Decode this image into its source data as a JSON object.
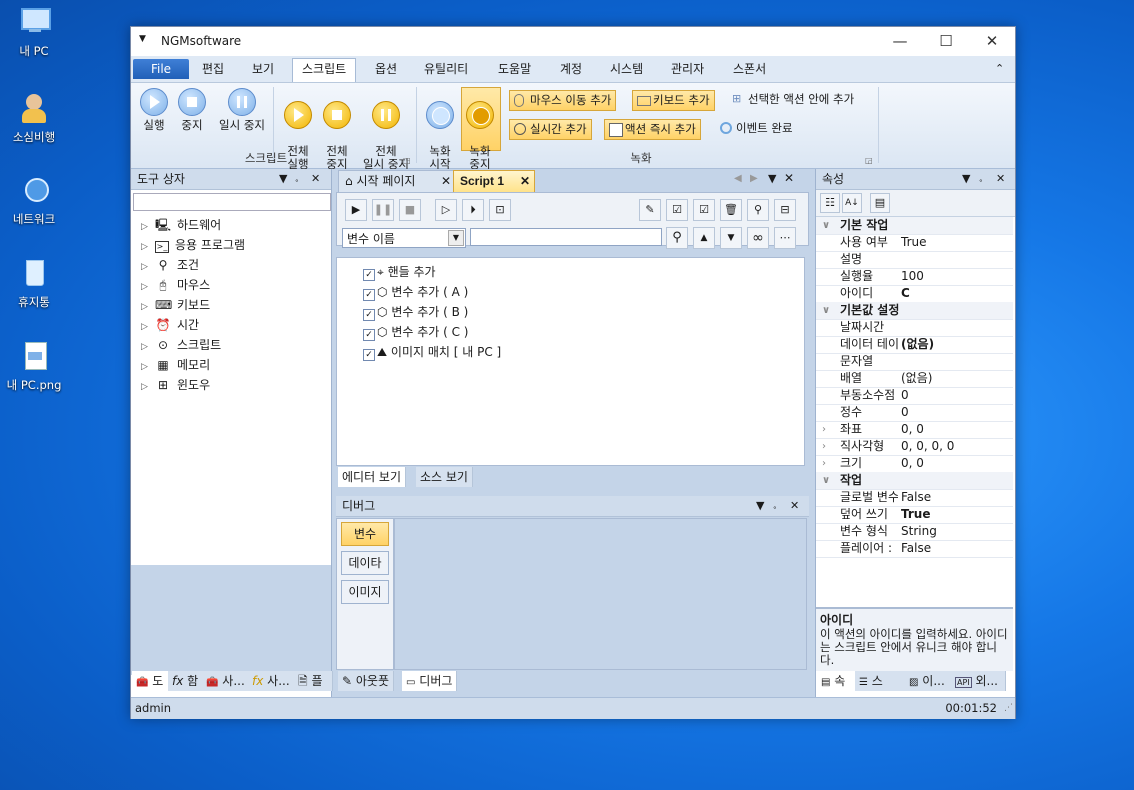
{
  "desktop": {
    "icons": [
      {
        "label": "내 PC",
        "icon": "computer-icon"
      },
      {
        "label": "소심비행",
        "icon": "user-folder-icon"
      },
      {
        "label": "네트워크",
        "icon": "network-icon"
      },
      {
        "label": "휴지통",
        "icon": "recycle-bin-icon"
      },
      {
        "label": "내 PC.png",
        "icon": "image-file-icon"
      }
    ]
  },
  "window": {
    "title": "NGMsoftware",
    "controls": {
      "minimize": "—",
      "maximize": "☐",
      "close": "✕"
    }
  },
  "menu": {
    "items": [
      "File",
      "편집",
      "보기",
      "스크립트",
      "옵션",
      "유틸리티",
      "도움말",
      "계정",
      "시스템",
      "관리자",
      "스폰서"
    ],
    "active": "스크립트",
    "collapse": "⌃"
  },
  "ribbon": {
    "script_group": {
      "label": "스크립트",
      "buttons": [
        "실행",
        "중지",
        "일시 중지",
        "전체\n실행",
        "전체\n중지",
        "전체\n일시 중지"
      ]
    },
    "record_group": {
      "label": "녹화",
      "record": "녹화\n시작",
      "stop": "녹화\n중지",
      "mouse_add": "마우스 이동 추가",
      "keyboard_add": "키보드 추가",
      "selected_add": "선택한 액션 안에 추가",
      "realtime_add": "실시간 추가",
      "instant_add": "액션 즉시 추가",
      "event_done": "이벤트 완료"
    }
  },
  "toolbox": {
    "title": "도구 상자",
    "search_value": "",
    "items": [
      "하드웨어",
      "응용 프로그램",
      "조건",
      "마우스",
      "키보드",
      "시간",
      "스크립트",
      "메모리",
      "윈도우"
    ],
    "bottom_tabs": [
      "도",
      "함",
      "사...",
      "사...",
      "플"
    ]
  },
  "editor": {
    "tabs": [
      "시작 페이지",
      "Script 1"
    ],
    "variable_select": "변수 이름",
    "search_value": "",
    "lines": [
      "핸들 추가",
      "변수 추가 ( A )",
      "변수 추가 ( B )",
      "변수 추가 ( C )",
      "이미지 매치 [ 내 PC ]"
    ],
    "view_tabs": [
      "에디터 보기",
      "소스 보기"
    ]
  },
  "debug": {
    "title": "디버그",
    "buttons": [
      "변수",
      "데이타",
      "이미지"
    ],
    "bottom_tabs": [
      "아웃풋",
      "디버그"
    ]
  },
  "properties": {
    "title": "속성",
    "categories": [
      {
        "name": "기본 작업",
        "rows": [
          {
            "k": "사용 여부",
            "v": "True",
            "bold": false
          },
          {
            "k": "설명",
            "v": "",
            "bold": false
          },
          {
            "k": "실행율",
            "v": "100",
            "bold": false
          },
          {
            "k": "아이디",
            "v": "C",
            "bold": true
          }
        ]
      },
      {
        "name": "기본값 설정",
        "rows": [
          {
            "k": "날짜시간",
            "v": "",
            "bold": false
          },
          {
            "k": "데이터 테이",
            "v": "(없음)",
            "bold": true
          },
          {
            "k": "문자열",
            "v": "",
            "bold": false
          },
          {
            "k": "배열",
            "v": "(없음)",
            "bold": false
          },
          {
            "k": "부동소수점",
            "v": "0",
            "bold": false
          },
          {
            "k": "정수",
            "v": "0",
            "bold": false
          },
          {
            "k": "좌표",
            "v": "0, 0",
            "bold": false,
            "exp": true
          },
          {
            "k": "직사각형",
            "v": "0, 0, 0, 0",
            "bold": false,
            "exp": true
          },
          {
            "k": "크기",
            "v": "0, 0",
            "bold": false,
            "exp": true
          }
        ]
      },
      {
        "name": "작업",
        "rows": [
          {
            "k": "글로벌 변수",
            "v": "False",
            "bold": false
          },
          {
            "k": "덮어 쓰기",
            "v": "True",
            "bold": true
          },
          {
            "k": "변수 형식",
            "v": "String",
            "bold": false
          },
          {
            "k": "플레이어 :",
            "v": "False",
            "bold": false
          }
        ]
      }
    ],
    "help_title": "아이디",
    "help_text": "이 액션의 아이디를 입력하세요. 아이디는 스크립트 안에서 유니크 해야 합니다.",
    "bottom_tabs": [
      "속",
      "스크...",
      "이...",
      "외..."
    ]
  },
  "statusbar": {
    "user": "admin",
    "time": "00:01:52"
  },
  "colors": {
    "accent": "#2160b8",
    "highlight": "#ffd266",
    "panel": "#c4d4e8"
  }
}
